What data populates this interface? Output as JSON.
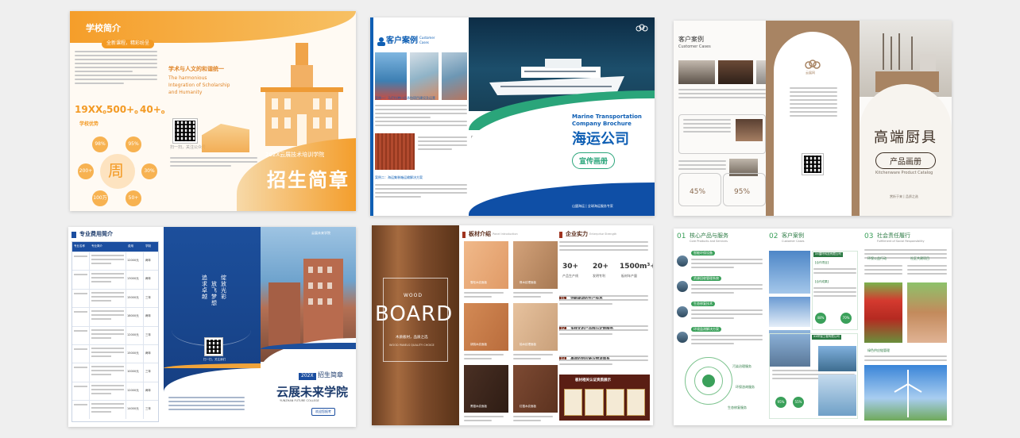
{
  "brochures": {
    "b1": {
      "section_title": "学校简介",
      "tag": "全新课程，精彩纷呈",
      "subtitle_cn": "学术与人文的和谐统一",
      "subtitle_en_1": "The harmonious",
      "subtitle_en_2": "Integration of Scholarship",
      "subtitle_en_3": "and Humanity",
      "stats": [
        "19XX。",
        "500+。",
        "40+。"
      ],
      "advantages_title": "学校优势",
      "center_char": "周",
      "ring_values": [
        "98%",
        "95%",
        "200+",
        "30%",
        "100万",
        "50+"
      ],
      "school_name": "202X云展技术培训学院",
      "headline": "招生简章",
      "scan_caption": "扫一扫，关注公众号"
    },
    "b2": {
      "section_title": "客户案例",
      "section_title_en_1": "Customer",
      "section_title_en_2": "Cases",
      "case1": "案例一：马尼拉港口总承包项目建设及运营",
      "case2": "案例二：海运集装箱运输解决方案",
      "title_en_1": "Marine Transportation",
      "title_en_2": "Company Brochure",
      "title_cn": "海运公司",
      "button": "宣传画册",
      "scan_caption": "扫一扫，关注公众号",
      "bottom": "山盟海运 | 全球海运服务专家"
    },
    "b3": {
      "section_title": "客户案例",
      "section_title_en": "Customer Cases",
      "pct1": "45%",
      "pct2": "95%",
      "logo_caption": "云展网",
      "title_cn": "高端厨具",
      "button": "产品画册",
      "title_en": "Kitchenware Product Catalog",
      "footer": "赏析于来 | 品质之选"
    },
    "b4": {
      "section_title": "专业费用简介",
      "table_headers": [
        "专业名称",
        "专业简介",
        "费用",
        "学制"
      ],
      "fees": [
        "12000元",
        "13000元",
        "15000元",
        "18000元",
        "12000元",
        "15000元",
        "10000元",
        "12000元",
        "14000元"
      ],
      "durations": [
        "两年",
        "两年",
        "三年",
        "两年",
        "三年",
        "两年",
        "三年",
        "两年",
        "三年"
      ],
      "poem_col1": "追求卓越",
      "poem_col2": "放飞梦想",
      "poem_col3": "绽放光彩",
      "school_tag": "云展未来学院",
      "year": "202X",
      "headline": "招生简章",
      "school_name": "云展未来学院",
      "school_name_en": "YUNZHAN FUTURE COLLEGE",
      "button": "欢迎您报考",
      "scan_caption": "扫一扫，关注我们"
    },
    "b5": {
      "wood_label": "WOOD",
      "board": "BOARD",
      "tagline": "木质板材，品质之选",
      "tagline_en": "WOOD PANELS QUALITY CHOICE",
      "section_title": "板材介绍",
      "section_title_en": "Panel Introduction",
      "samples": [
        "雪松木纹面板",
        "橡木纹理面板",
        "胡桃木纹面板",
        "柚木纹理面板",
        "黑檀木纹面板",
        "红檀木纹面板"
      ],
      "strength_title": "企业实力",
      "strength_en": "Enterprise Strength",
      "stats": [
        "30+",
        "20+",
        "1500m³+"
      ],
      "stat_labels": [
        "产品生产线",
        "发明专利",
        "板材年产量"
      ],
      "points": [
        "创新驱动的生产技术",
        "多样化的产品线与定制服务",
        "高效的供应链与物流体系"
      ],
      "cert_title": "板材相关认证资质展示"
    },
    "b6": {
      "s1": "核心产品与服务",
      "s1_en": "Core Products and Services",
      "s2": "客户案例",
      "s2_en": "Customer Cases",
      "s3": "社会责任履行",
      "s3_en": "Fulfillment of Social Responsibility",
      "items": [
        "智能环保设备",
        "资源回收管理系统",
        "生态修复技术",
        "环境监测解决方案"
      ],
      "circle_items": [
        "污染治理服务",
        "环保咨询服务",
        "生态修复服务"
      ],
      "case1": "XX循环科技有限公司",
      "case2": "XX环保工程有限公司",
      "case_sub": "【合作项目】",
      "case_sub2": "【合作成果】",
      "pcts": [
        "48%",
        "70%",
        "95%",
        "55%"
      ],
      "resp": [
        "环保公益行动",
        "社区共建项目",
        "绿色供应链管理"
      ]
    }
  }
}
